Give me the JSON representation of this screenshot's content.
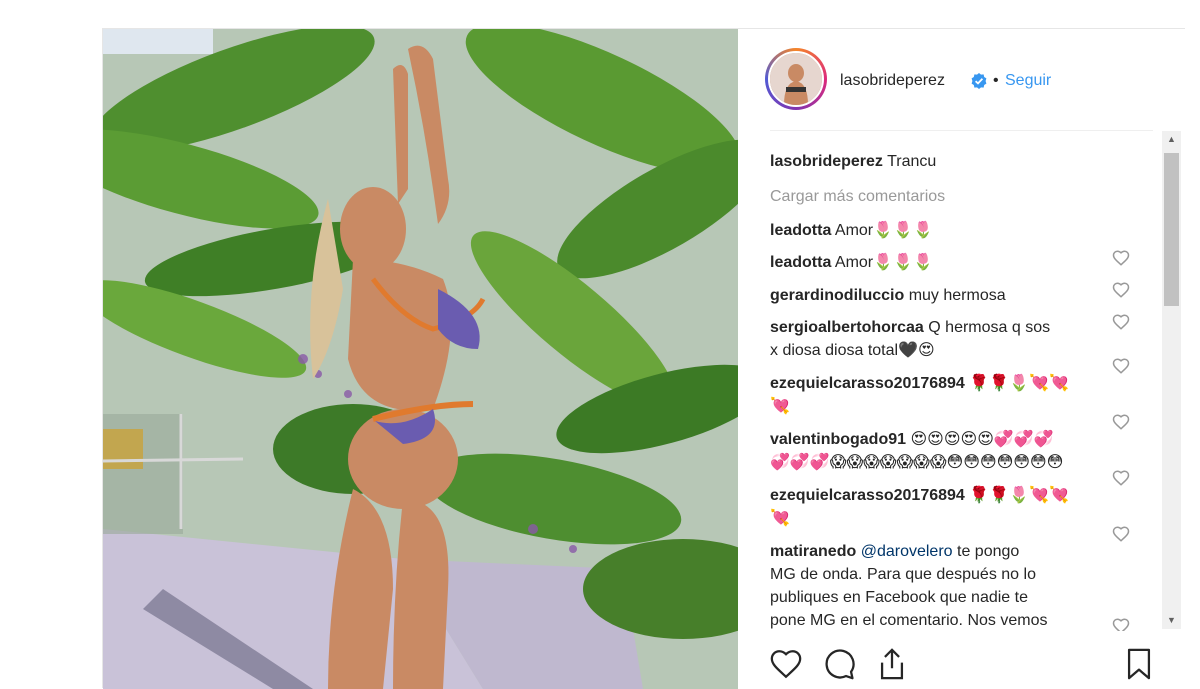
{
  "post": {
    "author": "lasobrideperez",
    "follow_label": "Seguir",
    "dot": "•",
    "caption": {
      "user": "lasobrideperez",
      "text": "Trancu"
    },
    "load_more": "Cargar más comentarios"
  },
  "comments": [
    {
      "user": "leadotta",
      "lines": [
        "Amor🌷🌷🌷"
      ]
    },
    {
      "user": "leadotta",
      "lines": [
        "Amor🌷🌷🌷"
      ]
    },
    {
      "user": "gerardinodiluccio",
      "lines": [
        "muy hermosa"
      ]
    },
    {
      "user": "sergioalbertohorcaa",
      "lines": [
        "Q hermosa q sos",
        "x diosa diosa total🖤😍"
      ]
    },
    {
      "user": "ezequielcarasso20176894",
      "lines": [
        "🌹🌹🌷💘💘",
        "💘"
      ]
    },
    {
      "user": "valentinbogado91",
      "lines": [
        "😍😍😍😍😍💞💞💞",
        "💞💞💞😱😱😱😱😱😱😱😳😳😳😳😳😳😳"
      ]
    },
    {
      "user": "ezequielcarasso20176894",
      "lines": [
        "🌹🌹🌷💘💘",
        "💘"
      ]
    },
    {
      "user": "matiranedo",
      "mention": "@darovelero",
      "lines": [
        "te pongo",
        "MG de onda. Para que después no lo",
        "publiques en Facebook que nadie te",
        "pone MG en el comentario. Nos vemos"
      ]
    }
  ],
  "colors": {
    "link": "#3897f0",
    "verified": "#3897f0",
    "mention": "#003569",
    "muted": "#999999"
  },
  "icons": [
    "verified-badge-icon",
    "heart-icon",
    "like-icon",
    "comment-icon",
    "share-icon",
    "bookmark-icon"
  ]
}
